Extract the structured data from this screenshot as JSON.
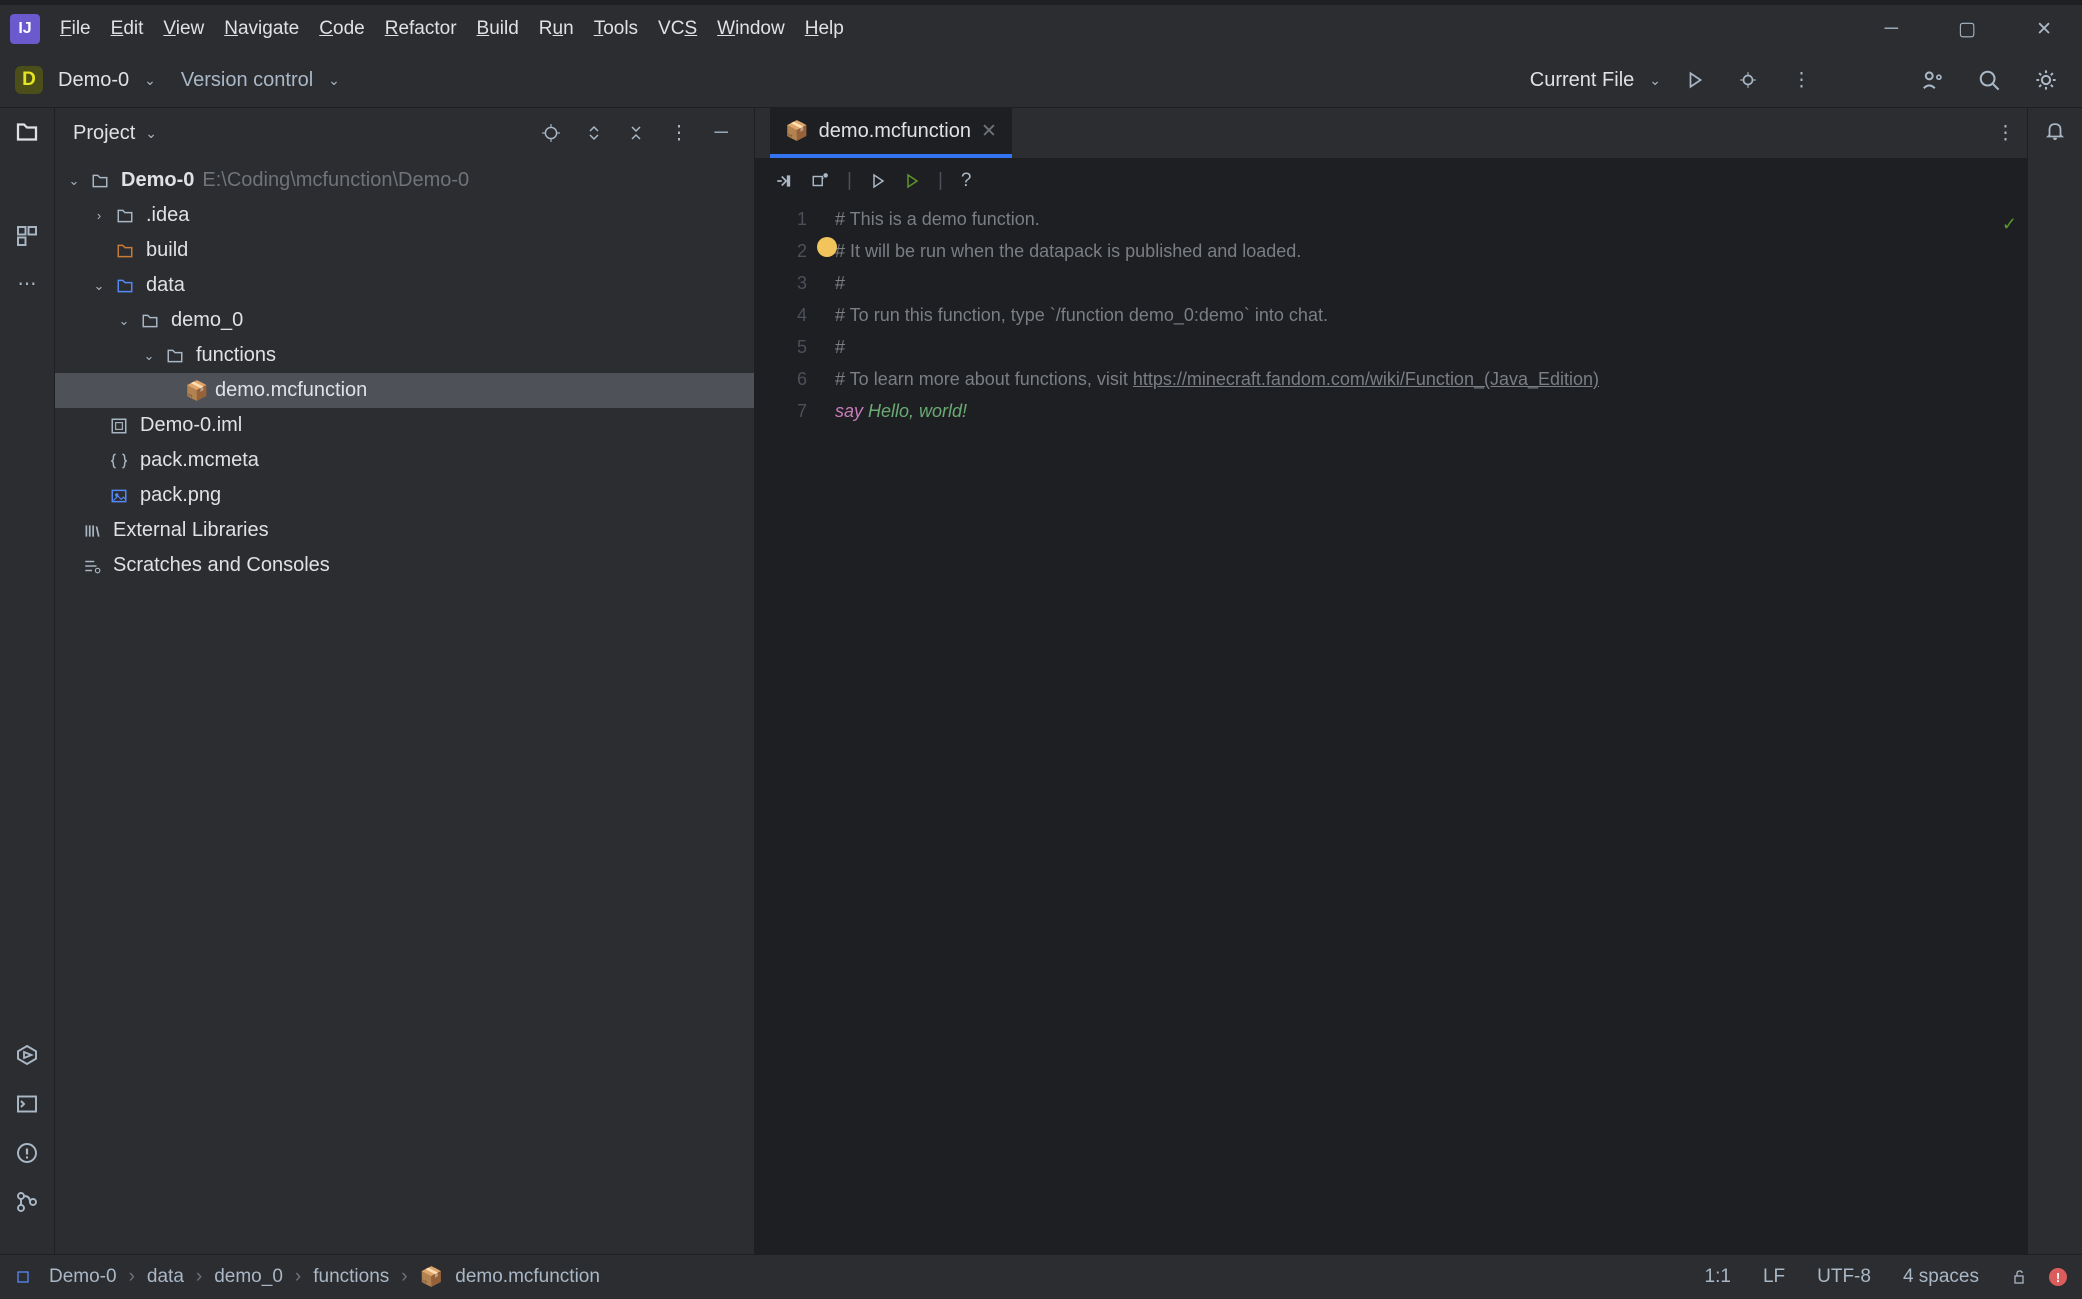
{
  "menu": {
    "file": "File",
    "edit": "Edit",
    "view": "View",
    "navigate": "Navigate",
    "code": "Code",
    "refactor": "Refactor",
    "build": "Build",
    "run": "Run",
    "tools": "Tools",
    "vcs": "VCS",
    "window": "Window",
    "help": "Help"
  },
  "toolbar": {
    "project_letter": "D",
    "project_name": "Demo-0",
    "version_control": "Version control",
    "run_config": "Current File"
  },
  "project_pane": {
    "title": "Project"
  },
  "tree": {
    "root": {
      "name": "Demo-0",
      "path": "E:\\Coding\\mcfunction\\Demo-0"
    },
    "idea": ".idea",
    "build": "build",
    "data": "data",
    "demo0": "demo_0",
    "functions": "functions",
    "demo_mc": "demo.mcfunction",
    "iml": "Demo-0.iml",
    "pack_mcmeta": "pack.mcmeta",
    "pack_png": "pack.png",
    "ext_lib": "External Libraries",
    "scratches": "Scratches and Consoles"
  },
  "tab": {
    "name": "demo.mcfunction"
  },
  "code": {
    "lines": [
      "1",
      "2",
      "3",
      "4",
      "5",
      "6",
      "7"
    ],
    "l1": "# This is a demo function.",
    "l2": "# It will be run when the datapack is published and loaded.",
    "l3": "#",
    "l4": "# To run this function, type `/function demo_0:demo` into chat.",
    "l5": "#",
    "l6_pre": "# To learn more about functions, visit ",
    "l6_link": "https://minecraft.fandom.com/wiki/Function_(Java_Edition)",
    "l7_kw": "say",
    "l7_rest": " Hello, world!"
  },
  "breadcrumbs": [
    "Demo-0",
    "data",
    "demo_0",
    "functions",
    "demo.mcfunction"
  ],
  "status": {
    "pos": "1:1",
    "sep": "LF",
    "enc": "UTF-8",
    "indent": "4 spaces"
  }
}
